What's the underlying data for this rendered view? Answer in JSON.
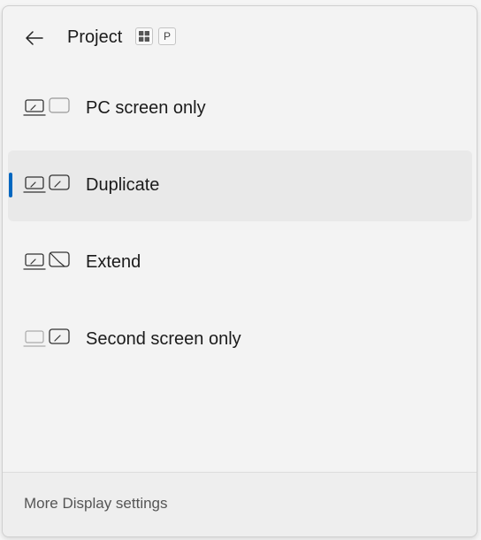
{
  "header": {
    "title": "Project",
    "shortcut_keys": [
      "win-logo",
      "P"
    ]
  },
  "options": [
    {
      "label": "PC screen only",
      "icon": "pc-screen-only-icon",
      "selected": false
    },
    {
      "label": "Duplicate",
      "icon": "duplicate-icon",
      "selected": true
    },
    {
      "label": "Extend",
      "icon": "extend-icon",
      "selected": false
    },
    {
      "label": "Second screen only",
      "icon": "second-screen-only-icon",
      "selected": false
    }
  ],
  "footer": {
    "link_label": "More Display settings"
  },
  "colors": {
    "accent": "#0067c0",
    "selected_bg": "#e9e9e9",
    "panel_bg": "#f3f3f3"
  }
}
